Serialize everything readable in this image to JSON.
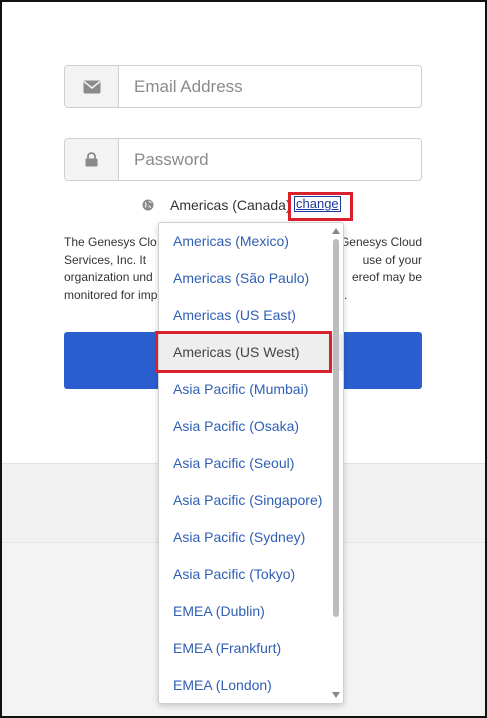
{
  "login": {
    "email_placeholder": "Email Address",
    "password_placeholder": "Password",
    "current_region": "Americas (Canada)",
    "change_label": "change",
    "legal_lines": [
      "The Genesys Clo",
      "Services, Inc. It",
      "organization und",
      "monitored for imp"
    ],
    "legal_right": [
      "Genesys Cloud",
      "use of your",
      "ereof may be",
      "."
    ],
    "signin_label": ""
  },
  "dropdown": {
    "options": [
      "Americas (Mexico)",
      "Americas (São Paulo)",
      "Americas (US East)",
      "Americas (US West)",
      "Asia Pacific (Mumbai)",
      "Asia Pacific (Osaka)",
      "Asia Pacific (Seoul)",
      "Asia Pacific (Singapore)",
      "Asia Pacific (Sydney)",
      "Asia Pacific (Tokyo)",
      "EMEA (Dublin)",
      "EMEA (Frankfurt)",
      "EMEA (London)"
    ],
    "hovered_option": "Americas (US West)"
  },
  "colors": {
    "accent": "#2b5fcf",
    "link": "#2f5fb3",
    "annotation": "#d9202c"
  },
  "icons": {
    "email": "envelope-icon",
    "password": "lock-icon",
    "region": "globe-icon"
  }
}
